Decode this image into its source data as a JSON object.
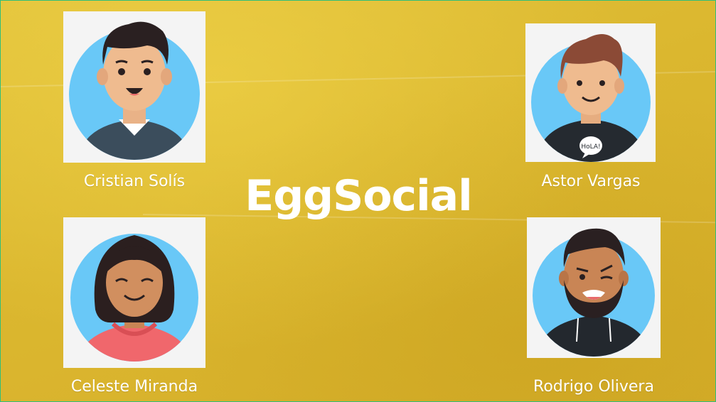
{
  "app": {
    "title": "EggSocial"
  },
  "profiles": [
    {
      "name": "Cristian Solís",
      "avatar_icon": "man-dark-hair-sweater-avatar-icon"
    },
    {
      "name": "Astor Vargas",
      "avatar_icon": "man-brown-hair-hola-shirt-avatar-icon",
      "shirt_text": "HoLA!"
    },
    {
      "name": "Celeste Miranda",
      "avatar_icon": "woman-long-hair-hoodie-avatar-icon"
    },
    {
      "name": "Rodrigo Olivera",
      "avatar_icon": "man-beard-winking-hoodie-avatar-icon"
    }
  ],
  "colors": {
    "background": "#dbb72f",
    "avatar_circle": "#69c8f7",
    "card_background": "#f4f4f4",
    "text": "#ffffff"
  }
}
